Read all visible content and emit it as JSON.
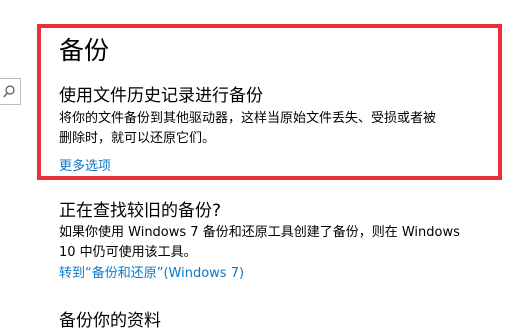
{
  "page": {
    "title": "备份"
  },
  "file_history": {
    "heading": "使用文件历史记录进行备份",
    "description_line1": "将你的文件备份到其他驱动器，这样当原始文件丢失、受损或者被",
    "description_line2": "删除时，就可以还原它们。",
    "more_options_link": "更多选项"
  },
  "older_backup": {
    "heading": "正在查找较旧的备份?",
    "description_line1": "如果你使用 Windows 7 备份和还原工具创建了备份，则在 Windows",
    "description_line2": "10 中仍可使用该工具。",
    "goto_link": "转到“备份和还原”(Windows 7)"
  },
  "next_section": {
    "heading": "备份你的资料"
  },
  "icons": {
    "search": "search-icon"
  },
  "colors": {
    "highlight_border": "#e8303a",
    "link": "#0b79c6"
  }
}
